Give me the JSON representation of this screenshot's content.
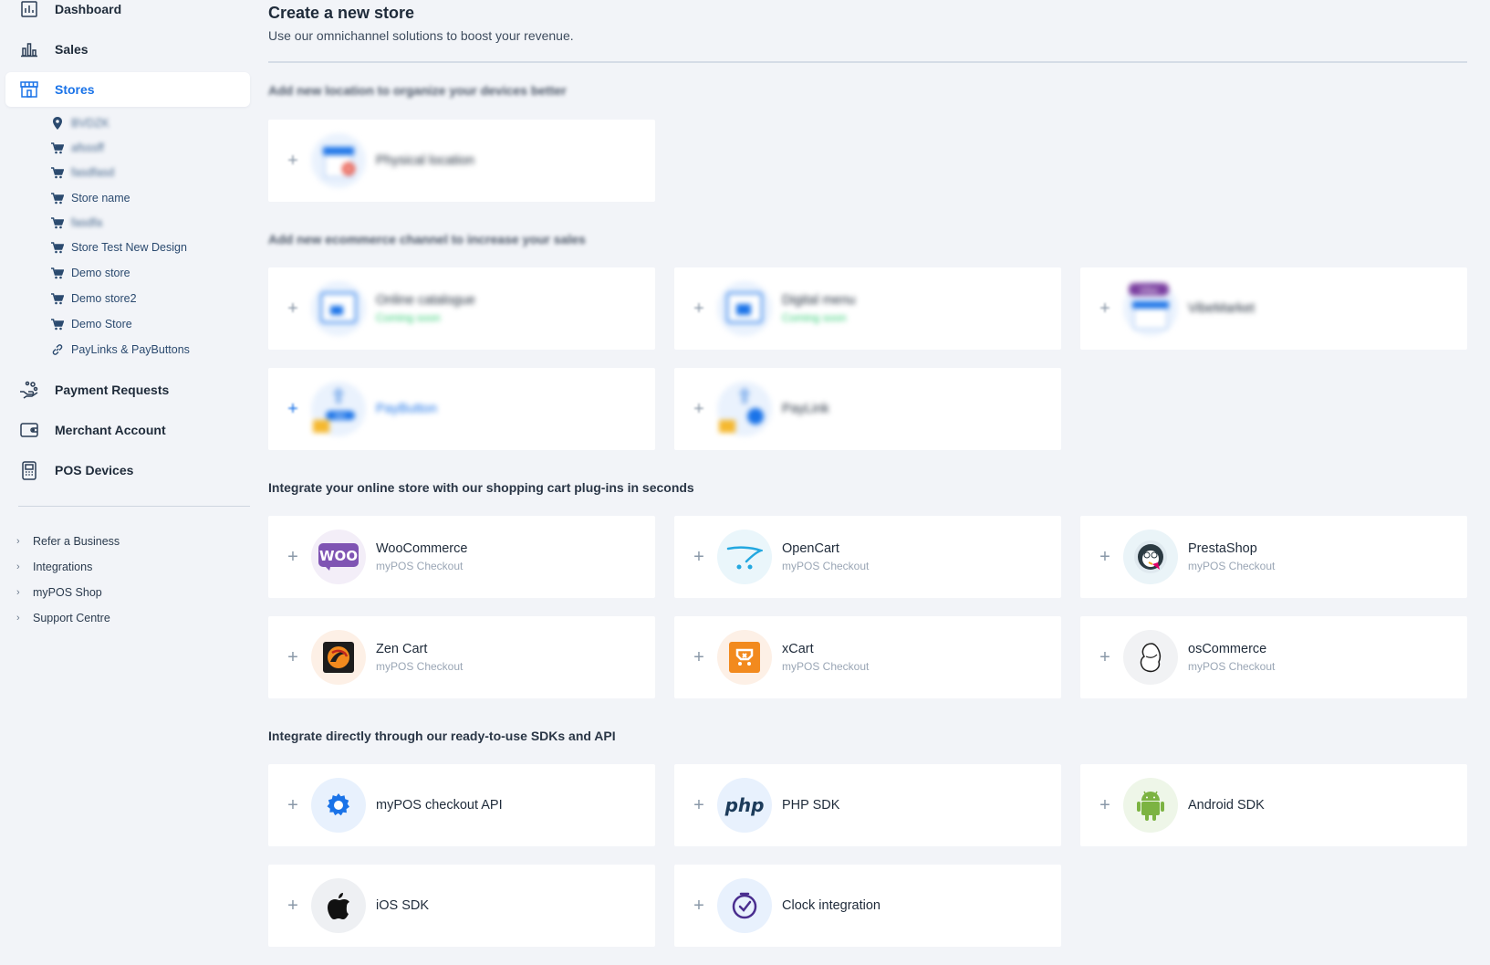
{
  "sidebar": {
    "nav": [
      {
        "label": "Dashboard",
        "icon": "dashboard-icon"
      },
      {
        "label": "Sales",
        "icon": "bar-chart-icon"
      },
      {
        "label": "Stores",
        "icon": "storefront-icon"
      }
    ],
    "stores": [
      {
        "label": "BVDZK",
        "icon": "location-pin-icon",
        "blurred": true
      },
      {
        "label": "afsssff",
        "icon": "cart-icon",
        "blurred": true
      },
      {
        "label": "fasdfasd",
        "icon": "cart-icon",
        "blurred": true
      },
      {
        "label": "Store name",
        "icon": "cart-icon",
        "blurred": false
      },
      {
        "label": "fasdfa",
        "icon": "cart-icon",
        "blurred": true
      },
      {
        "label": "Store Test New Design",
        "icon": "cart-icon",
        "blurred": false
      },
      {
        "label": "Demo store",
        "icon": "cart-icon",
        "blurred": false
      },
      {
        "label": "Demo store2",
        "icon": "cart-icon",
        "blurred": false
      },
      {
        "label": "Demo Store",
        "icon": "cart-icon",
        "blurred": false
      },
      {
        "label": "PayLinks & PayButtons",
        "icon": "link-icon",
        "blurred": false
      }
    ],
    "nav_bottom": [
      {
        "label": "Payment Requests",
        "icon": "payment-request-icon"
      },
      {
        "label": "Merchant Account",
        "icon": "wallet-icon"
      },
      {
        "label": "POS Devices",
        "icon": "pos-device-icon"
      }
    ],
    "links": [
      {
        "label": "Refer a Business"
      },
      {
        "label": "Integrations"
      },
      {
        "label": "myPOS Shop"
      },
      {
        "label": "Support Centre"
      }
    ]
  },
  "main": {
    "title": "Create a new store",
    "subtitle": "Use our omnichannel solutions to boost your revenue.",
    "sections": [
      {
        "heading": "Add new location to organize your devices better"
      },
      {
        "heading": "Add new ecommerce channel to increase your sales"
      },
      {
        "heading": "Integrate your online store with our shopping cart plug-ins in seconds"
      },
      {
        "heading": "Integrate directly through our ready-to-use SDKs and API"
      }
    ],
    "cards": {
      "physical": {
        "name": "Physical location"
      },
      "catalogue": {
        "name": "Online catalogue",
        "note": "Coming soon"
      },
      "menu": {
        "name": "Digital menu",
        "note": "Coming soon"
      },
      "vibe": {
        "name": "VibeMarket",
        "badge": "Vibe"
      },
      "paybutton": {
        "name": "PayButton",
        "button_text": "PAY"
      },
      "paylink": {
        "name": "PayLink"
      },
      "woo": {
        "name": "WooCommerce",
        "note": "myPOS Checkout",
        "logo_text": "WOO"
      },
      "opencart": {
        "name": "OpenCart",
        "note": "myPOS Checkout"
      },
      "prestashop": {
        "name": "PrestaShop",
        "note": "myPOS Checkout"
      },
      "zencart": {
        "name": "Zen Cart",
        "note": "myPOS Checkout"
      },
      "xcart": {
        "name": "xCart",
        "note": "myPOS Checkout"
      },
      "oscommerce": {
        "name": "osCommerce",
        "note": "myPOS Checkout"
      },
      "api": {
        "name": "myPOS checkout API"
      },
      "php": {
        "name": "PHP SDK",
        "logo_text": "php"
      },
      "android": {
        "name": "Android SDK"
      },
      "ios": {
        "name": "iOS SDK"
      },
      "clock": {
        "name": "Clock integration"
      }
    },
    "plus_symbol": "+"
  },
  "colors": {
    "accent": "#1a73e8",
    "background": "#f2f4f8",
    "coming_soon": "#2ecc71",
    "woo_purple": "#7f54b3",
    "android_green": "#7cb342"
  }
}
